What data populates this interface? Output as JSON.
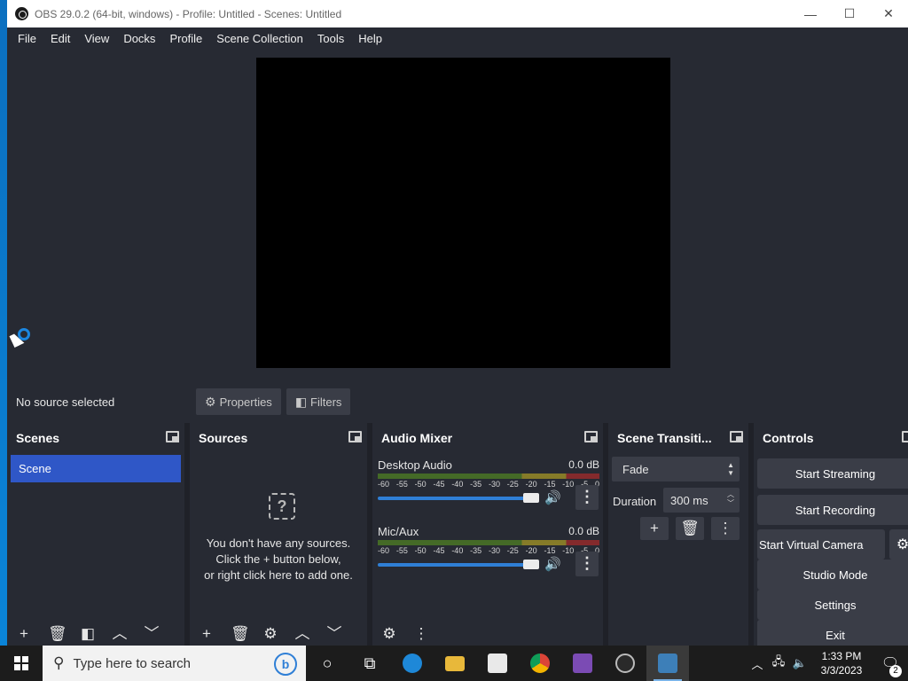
{
  "window": {
    "title": "OBS 29.0.2 (64-bit, windows) - Profile: Untitled - Scenes: Untitled",
    "minimize": "—",
    "maximize": "☐",
    "close": "✕"
  },
  "menu": [
    "File",
    "Edit",
    "View",
    "Docks",
    "Profile",
    "Scene Collection",
    "Tools",
    "Help"
  ],
  "source_bar": {
    "status": "No source selected",
    "properties_label": "Properties",
    "filters_label": "Filters"
  },
  "scenes": {
    "title": "Scenes",
    "items": [
      "Scene"
    ]
  },
  "sources": {
    "title": "Sources",
    "empty_line1": "You don't have any sources.",
    "empty_line2": "Click the + button below,",
    "empty_line3": "or right click here to add one."
  },
  "mixer": {
    "title": "Audio Mixer",
    "scale": [
      "-60",
      "-55",
      "-50",
      "-45",
      "-40",
      "-35",
      "-30",
      "-25",
      "-20",
      "-15",
      "-10",
      "-5",
      "0"
    ],
    "channels": [
      {
        "name": "Desktop Audio",
        "db": "0.0 dB",
        "volume": 1.0
      },
      {
        "name": "Mic/Aux",
        "db": "0.0 dB",
        "volume": 1.0
      }
    ]
  },
  "transitions": {
    "title": "Scene Transiti...",
    "selected": "Fade",
    "duration_label": "Duration",
    "duration_value": "300 ms"
  },
  "controls": {
    "title": "Controls",
    "start_streaming": "Start Streaming",
    "start_recording": "Start Recording",
    "start_virtual_camera": "Start Virtual Camera",
    "studio_mode": "Studio Mode",
    "settings": "Settings",
    "exit": "Exit"
  },
  "taskbar": {
    "search_placeholder": "Type here to search",
    "time": "1:33 PM",
    "date": "3/3/2023",
    "notifications": "2"
  },
  "colors": {
    "accent": "#2f57c7",
    "panel": "#272a33",
    "button": "#3a3d47",
    "volume": "#2f7fd6"
  }
}
